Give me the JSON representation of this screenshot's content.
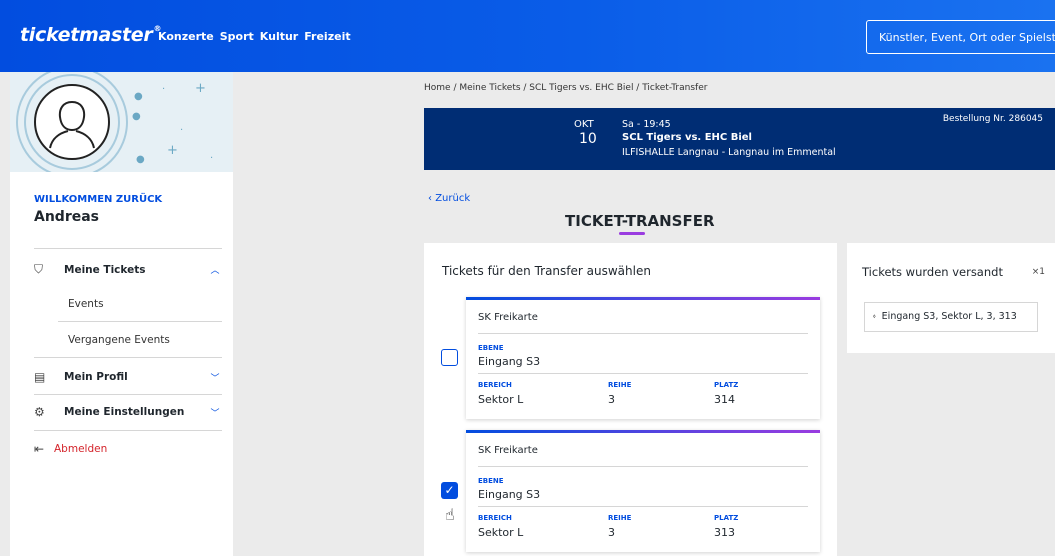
{
  "header": {
    "logo": "ticketmaster",
    "logo_mark": "®",
    "nav": [
      "Konzerte",
      "Sport",
      "Kultur",
      "Freizeit"
    ],
    "search_placeholder": "Künstler, Event, Ort oder Spielstä"
  },
  "sidebar": {
    "welcome": "WILLKOMMEN ZURÜCK",
    "username": "Andreas",
    "items": {
      "tickets": "Meine Tickets",
      "events": "Events",
      "past_events": "Vergangene Events",
      "profile": "Mein Profil",
      "settings": "Meine Einstellungen",
      "logout": "Abmelden"
    }
  },
  "breadcrumb": "Home / Meine Tickets / SCL Tigers vs. EHC Biel / Ticket-Transfer",
  "event": {
    "month": "OKT",
    "day": "10",
    "time": "Sa - 19:45",
    "title": "SCL Tigers vs. EHC Biel",
    "venue": "ILFISHALLE Langnau - Langnau im Emmental",
    "order": "Bestellung Nr. 286045"
  },
  "back_label": "Zurück",
  "page_title": "TICKET-TRANSFER",
  "transfer": {
    "heading": "Tickets für den Transfer auswählen",
    "labels": {
      "ebene": "EBENE",
      "bereich": "BEREICH",
      "reihe": "REIHE",
      "platz": "PLATZ"
    },
    "tickets": [
      {
        "type": "SK Freikarte",
        "ebene": "Eingang S3",
        "bereich": "Sektor L",
        "reihe": "3",
        "platz": "314",
        "selected": false
      },
      {
        "type": "SK Freikarte",
        "ebene": "Eingang S3",
        "bereich": "Sektor L",
        "reihe": "3",
        "platz": "313",
        "selected": true
      }
    ]
  },
  "sent": {
    "heading": "Tickets wurden versandt",
    "count": "×1",
    "item": "Eingang S3, Sektor L, 3, 313"
  },
  "colors": {
    "brand": "#024ddf",
    "event_bar": "#002d74",
    "accent": "#9a3ce0",
    "logout": "#d4242b"
  }
}
